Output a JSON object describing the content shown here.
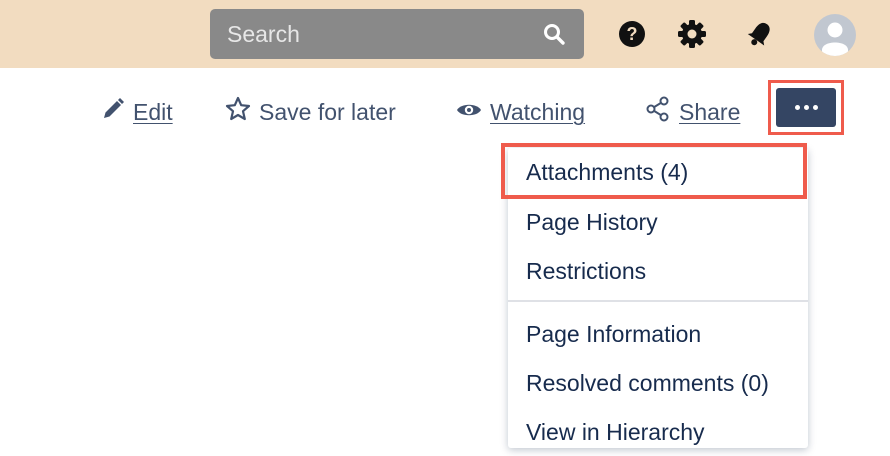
{
  "topbar": {
    "search_placeholder": "Search",
    "icons": [
      "search-icon",
      "help-icon",
      "settings-icon",
      "notifications-icon",
      "avatar-icon"
    ]
  },
  "actions": {
    "edit_label": "Edit",
    "save_label": "Save for later",
    "watching_label": "Watching",
    "share_label": "Share",
    "more_icon": "more-icon"
  },
  "menu": {
    "items": [
      "Attachments (4)",
      "Page History",
      "Restrictions",
      "Page Information",
      "Resolved comments (0)",
      "View in Hierarchy"
    ]
  },
  "colors": {
    "topbar_bg": "#f2dcc0",
    "search_bg": "#898989",
    "highlight": "#ef5b4c",
    "primary_text": "#172b4d",
    "more_button": "#344563"
  }
}
